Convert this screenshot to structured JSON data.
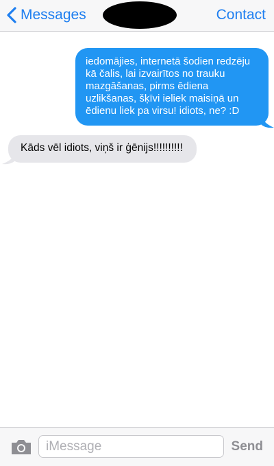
{
  "header": {
    "back_label": "Messages",
    "contact_label": "Contact"
  },
  "messages": [
    {
      "direction": "outgoing",
      "text": "iedomājies, internetā šodien redzēju kā čalis, lai izvairītos no trauku mazgāšanas, pirms ēdiena uzlikšanas, šķīvi ieliek maisiņā un ēdienu liek pa virsu! idiots, ne? :D"
    },
    {
      "direction": "incoming",
      "text": "Kāds vēl idiots, viņš ir ģēnijs!!!!!!!!!!"
    }
  ],
  "composer": {
    "placeholder": "iMessage",
    "send_label": "Send"
  },
  "icons": {
    "back": "chevron-left-icon",
    "camera": "camera-icon"
  },
  "colors": {
    "accent": "#1f7ff0",
    "outgoing_bubble": "#2196f3",
    "incoming_bubble": "#e6e6ea"
  }
}
